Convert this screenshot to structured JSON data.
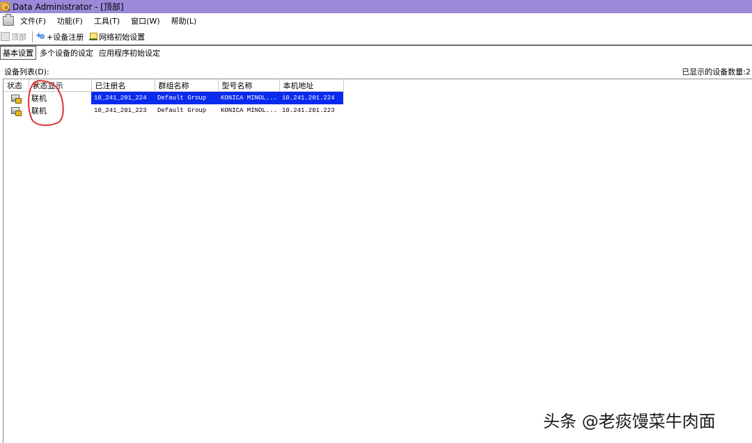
{
  "window": {
    "title": "Data Administrator - [顶部]"
  },
  "menu": {
    "items": [
      "文件(F)",
      "功能(F)",
      "工具(T)",
      "窗口(W)",
      "帮助(L)"
    ]
  },
  "toolbar": {
    "top_label": "顶部",
    "register_label": "+设备注册",
    "network_label": "网络初始设置"
  },
  "tabs": [
    "基本设置",
    "多个设备的设定",
    "应用程序初始设定"
  ],
  "device_list": {
    "label": "设备列表(D):",
    "count_text": "已显示的设备数量:2",
    "columns": [
      "状态",
      "状态显示",
      "已注册名",
      "群组名称",
      "型号名称",
      "本机地址"
    ],
    "rows": [
      {
        "status_display": "联机",
        "registered_name": "10_241_201_224",
        "group": "Default Group",
        "model": "KONICA MINOL...",
        "address": "10.241.201.224",
        "selected": true
      },
      {
        "status_display": "联机",
        "registered_name": "10_241_201_223",
        "group": "Default Group",
        "model": "KONICA MINOL...",
        "address": "10.241.201.223",
        "selected": false
      }
    ]
  },
  "watermark": "头条 @老痰馒菜牛肉面",
  "colors": {
    "titlebar": "#9a8ad8",
    "selection": "#0a2aee",
    "annotation": "#e03030"
  }
}
